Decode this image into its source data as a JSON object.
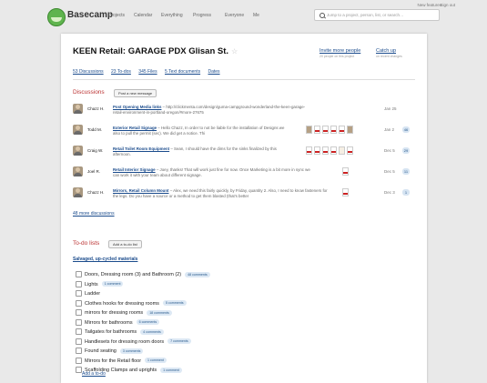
{
  "app": {
    "name": "Basecamp"
  },
  "nav": [
    "Projects",
    "Calendar",
    "Everything",
    "Progress",
    "Everyone",
    "Me"
  ],
  "top_links": {
    "whats_new": "New features",
    "sign_out": "Sign out"
  },
  "search": {
    "placeholder": "Jump to a project, person, list, or search…"
  },
  "project": {
    "title": "KEEN Retail: GARAGE PDX Glisan St.",
    "invite_label": "Invite more people",
    "invite_sub": "20 people on this project",
    "catchup_label": "Catch up",
    "catchup_sub": "on recent changes",
    "tabs": [
      "53 Discussions",
      "23 To-dos",
      "345 Files",
      "5 Text documents",
      "Dates"
    ]
  },
  "discussions": {
    "heading": "Discussions",
    "post_button": "Post a new message",
    "items": [
      {
        "author": "Chazz H.",
        "subject": "Post Opening Media links",
        "excerpt": "http://clickmenta.com/design/guma-campground-wonderland-the-keen-garage-retail-environment-in-portland-oregon/#more-27675",
        "date": "Jan 25",
        "count": ""
      },
      {
        "author": "Todd M.",
        "subject": "Exterior Retail Signage",
        "excerpt": "Hello Chazz, In order to not be liable for the installation of Designs we also to pull the permit (sec). We did get a notice. Thi",
        "date": "Jan 2",
        "count": "46"
      },
      {
        "author": "Craig W.",
        "subject": "Retail Toilet Room Equipment",
        "excerpt": "Sean, I should have the dims for the sinks finalized by this afternoon.",
        "date": "Dec 5",
        "count": "29"
      },
      {
        "author": "Joel R.",
        "subject": "Retail Interior Signage",
        "excerpt": "Joey, thanks! That will work just fine for now. Once Marketing is a bit more in sync we can work it with your team about different signage.",
        "date": "Dec 5",
        "count": "11"
      },
      {
        "author": "Chazz H.",
        "subject": "Mirrors, Retail Column Mount",
        "excerpt": "Alex, we need this fairly quickly, by Friday, quantity 2. Also, I need to know fasteners for the legs. Do you have a source or a method to get them blasted (that's better",
        "date": "Dec 3",
        "count": "1"
      }
    ],
    "more_label": "48 more discussions"
  },
  "todos": {
    "heading": "To-do lists",
    "add_list_button": "Add a to-do list",
    "list_title": "Salvaged, up-cycled materials",
    "items": [
      {
        "text": "Doors, Dressing room (3) and Bathroom (2)",
        "comments": "48 comments"
      },
      {
        "text": "Lights",
        "comments": "1 comment"
      },
      {
        "text": "Ladder",
        "comments": ""
      },
      {
        "text": "Clothes hooks for dressing rooms",
        "comments": "5 comments"
      },
      {
        "text": "mirrors for dressing rooms",
        "comments": "18 comments"
      },
      {
        "text": "Mirrors for bathrooms",
        "comments": "6 comments"
      },
      {
        "text": "Tailgates for bathrooms",
        "comments": "4 comments"
      },
      {
        "text": "Handlesets for dressing room doors",
        "comments": "7 comments"
      },
      {
        "text": "Found seating",
        "comments": "3 comments"
      },
      {
        "text": "Mirrors for the Retail floor",
        "comments": "1 comment"
      },
      {
        "text": "Scaffolding Clamps and uprights",
        "comments": "1 comment"
      }
    ],
    "add_todo_label": "Add a to-do"
  }
}
